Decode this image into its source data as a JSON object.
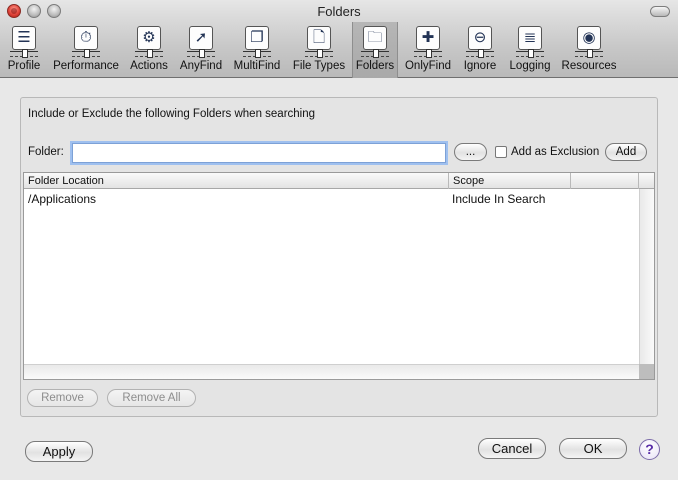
{
  "window": {
    "title": "Folders"
  },
  "toolbar": {
    "items": [
      {
        "label": "Profile",
        "icon": "profile-icon",
        "glyph": "☰",
        "selected": false
      },
      {
        "label": "Performance",
        "icon": "performance-icon",
        "glyph": "⏱",
        "selected": false
      },
      {
        "label": "Actions",
        "icon": "gear-icon",
        "glyph": "⚙",
        "selected": false
      },
      {
        "label": "AnyFind",
        "icon": "anyfind-icon",
        "glyph": "➚",
        "selected": false
      },
      {
        "label": "MultiFind",
        "icon": "multifind-icon",
        "glyph": "❐",
        "selected": false
      },
      {
        "label": "File Types",
        "icon": "file-types-icon",
        "glyph": "🗋",
        "selected": false
      },
      {
        "label": "Folders",
        "icon": "folders-icon",
        "glyph": "🗀",
        "selected": true
      },
      {
        "label": "OnlyFind",
        "icon": "onlyfind-icon",
        "glyph": "✚",
        "selected": false
      },
      {
        "label": "Ignore",
        "icon": "ignore-icon",
        "glyph": "⊖",
        "selected": false
      },
      {
        "label": "Logging",
        "icon": "logging-icon",
        "glyph": "≣",
        "selected": false
      },
      {
        "label": "Resources",
        "icon": "resources-icon",
        "glyph": "◉",
        "selected": false
      }
    ]
  },
  "panel": {
    "instruction": "Include or Exclude the following Folders when searching",
    "folder_label": "Folder:",
    "folder_value": "",
    "browse_label": "...",
    "exclusion_label": "Add as Exclusion",
    "exclusion_checked": false,
    "add_label": "Add",
    "table": {
      "columns": [
        "Folder Location",
        "Scope",
        ""
      ],
      "rows": [
        {
          "location": "/Applications",
          "scope": "Include In Search"
        }
      ]
    },
    "remove_label": "Remove",
    "remove_all_label": "Remove All"
  },
  "footer": {
    "apply_label": "Apply",
    "cancel_label": "Cancel",
    "ok_label": "OK",
    "help_label": "?"
  },
  "colors": {
    "focus_ring": "#9fc0ef",
    "help_accent": "#5a2ea8",
    "close_button": "#e0443a"
  }
}
